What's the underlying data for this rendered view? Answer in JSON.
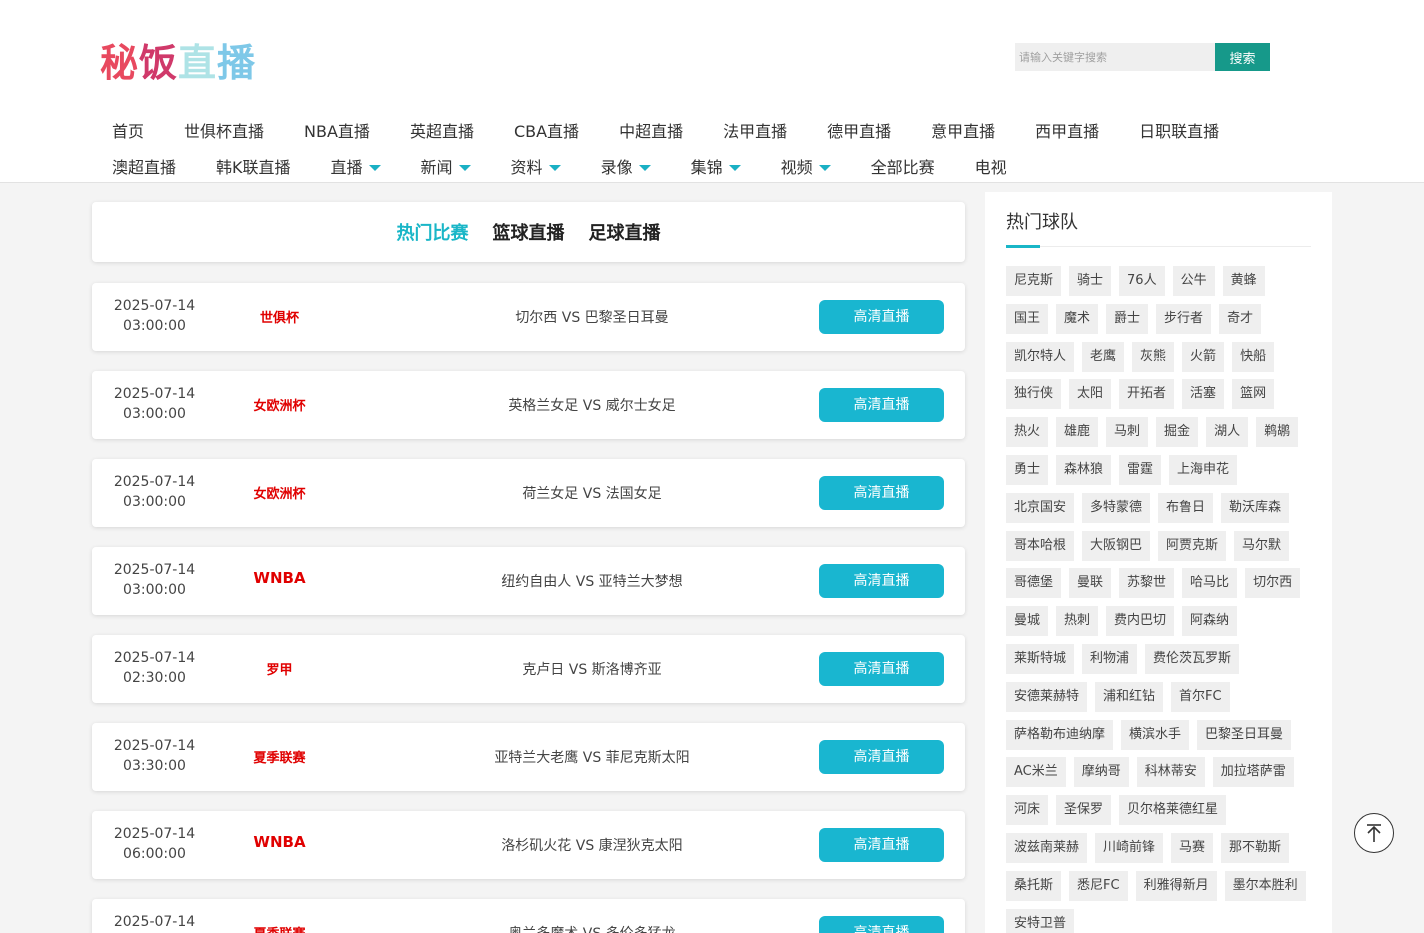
{
  "logo": {
    "chars": [
      "秘",
      "饭",
      "直",
      "播"
    ]
  },
  "search": {
    "placeholder": "请输入关键字搜索",
    "button": "搜索"
  },
  "nav": {
    "row1": [
      "首页",
      "世俱杯直播",
      "NBA直播",
      "英超直播",
      "CBA直播",
      "中超直播",
      "法甲直播",
      "德甲直播",
      "意甲直播",
      "西甲直播",
      "日职联直播"
    ],
    "row2": [
      {
        "label": "澳超直播",
        "dropdown": false
      },
      {
        "label": "韩K联直播",
        "dropdown": false
      },
      {
        "label": "直播",
        "dropdown": true
      },
      {
        "label": "新闻",
        "dropdown": true
      },
      {
        "label": "资料",
        "dropdown": true
      },
      {
        "label": "录像",
        "dropdown": true
      },
      {
        "label": "集锦",
        "dropdown": true
      },
      {
        "label": "视频",
        "dropdown": true
      },
      {
        "label": "全部比赛",
        "dropdown": false
      },
      {
        "label": "电视",
        "dropdown": false
      }
    ]
  },
  "tabs": [
    "热门比赛",
    "篮球直播",
    "足球直播"
  ],
  "active_tab": 0,
  "matches": [
    {
      "date": "2025-07-14",
      "time": "03:00:00",
      "league": "世俱杯",
      "teams": "切尔西 VS 巴黎圣日耳曼",
      "button": "高清直播"
    },
    {
      "date": "2025-07-14",
      "time": "03:00:00",
      "league": "女欧洲杯",
      "teams": "英格兰女足 VS 威尔士女足",
      "button": "高清直播"
    },
    {
      "date": "2025-07-14",
      "time": "03:00:00",
      "league": "女欧洲杯",
      "teams": "荷兰女足 VS 法国女足",
      "button": "高清直播"
    },
    {
      "date": "2025-07-14",
      "time": "03:00:00",
      "league": "WNBA",
      "teams": "纽约自由人 VS 亚特兰大梦想",
      "button": "高清直播"
    },
    {
      "date": "2025-07-14",
      "time": "02:30:00",
      "league": "罗甲",
      "teams": "克卢日 VS 斯洛博齐亚",
      "button": "高清直播"
    },
    {
      "date": "2025-07-14",
      "time": "03:30:00",
      "league": "夏季联赛",
      "teams": "亚特兰大老鹰 VS 菲尼克斯太阳",
      "button": "高清直播"
    },
    {
      "date": "2025-07-14",
      "time": "06:00:00",
      "league": "WNBA",
      "teams": "洛杉矶火花 VS 康涅狄克太阳",
      "button": "高清直播"
    },
    {
      "date": "2025-07-14",
      "time": "",
      "league": "夏季联赛",
      "teams": "奥兰多魔术 VS 多伦多猛龙",
      "button": "高清直播"
    }
  ],
  "sidebar": {
    "title": "热门球队",
    "teams": [
      "尼克斯",
      "骑士",
      "76人",
      "公牛",
      "黄蜂",
      "国王",
      "魔术",
      "爵士",
      "步行者",
      "奇才",
      "凯尔特人",
      "老鹰",
      "灰熊",
      "火箭",
      "快船",
      "独行侠",
      "太阳",
      "开拓者",
      "活塞",
      "篮网",
      "热火",
      "雄鹿",
      "马刺",
      "掘金",
      "湖人",
      "鹈鹕",
      "勇士",
      "森林狼",
      "雷霆",
      "上海申花",
      "北京国安",
      "多特蒙德",
      "布鲁日",
      "勒沃库森",
      "哥本哈根",
      "大阪钢巴",
      "阿贾克斯",
      "马尔默",
      "哥德堡",
      "曼联",
      "苏黎世",
      "哈马比",
      "切尔西",
      "曼城",
      "热刺",
      "费内巴切",
      "阿森纳",
      "莱斯特城",
      "利物浦",
      "费伦茨瓦罗斯",
      "安德莱赫特",
      "浦和红钻",
      "首尔FC",
      "萨格勒布迪纳摩",
      "横滨水手",
      "巴黎圣日耳曼",
      "AC米兰",
      "摩纳哥",
      "科林蒂安",
      "加拉塔萨雷",
      "河床",
      "圣保罗",
      "贝尔格莱德红星",
      "波兹南莱赫",
      "川崎前锋",
      "马赛",
      "那不勒斯",
      "桑托斯",
      "悉尼FC",
      "利雅得新月",
      "墨尔本胜利",
      "安特卫普"
    ]
  },
  "colors": {
    "accent": "#19b6c7",
    "search_button": "#16998a",
    "league_red": "#e00000",
    "live_button": "#19b6d0"
  },
  "icons": {
    "dropdown": "caret-down-icon",
    "back_to_top": "arrow-up-icon"
  }
}
